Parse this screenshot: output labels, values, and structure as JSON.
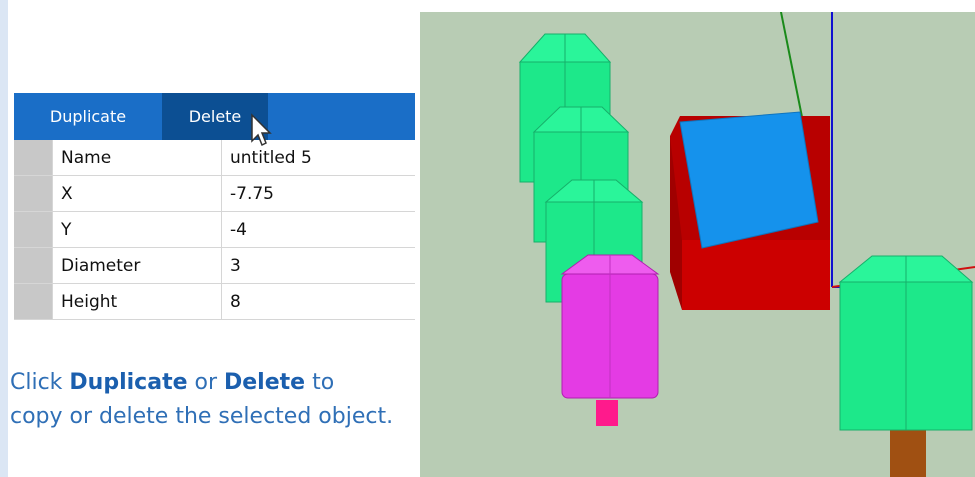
{
  "toolbar": {
    "duplicate_label": "Duplicate",
    "delete_label": "Delete"
  },
  "properties": [
    {
      "name": "Name",
      "value": "untitled 5"
    },
    {
      "name": "X",
      "value": "-7.75"
    },
    {
      "name": "Y",
      "value": "-4"
    },
    {
      "name": "Diameter",
      "value": "3"
    },
    {
      "name": "Height",
      "value": "8"
    }
  ],
  "hint": {
    "part1": "Click ",
    "duplicate": "Duplicate",
    "part2": " or ",
    "delete": "Delete",
    "part3": " to",
    "line2": "copy or delete the selected object."
  },
  "colors": {
    "toolbar_bg": "#1a6ec7",
    "toolbar_active": "#0c4f93",
    "hint_text": "#2f6fb6",
    "viewport_bg": "#b8ccb4",
    "tree_green": "#1de88a",
    "selected_magenta": "#e43be4",
    "box_red": "#c40000",
    "box_blue": "#1592ec"
  },
  "viewport": {
    "objects": [
      "tree",
      "tree",
      "tree",
      "selected-cylinder",
      "red-box",
      "blue-box",
      "tree"
    ]
  }
}
